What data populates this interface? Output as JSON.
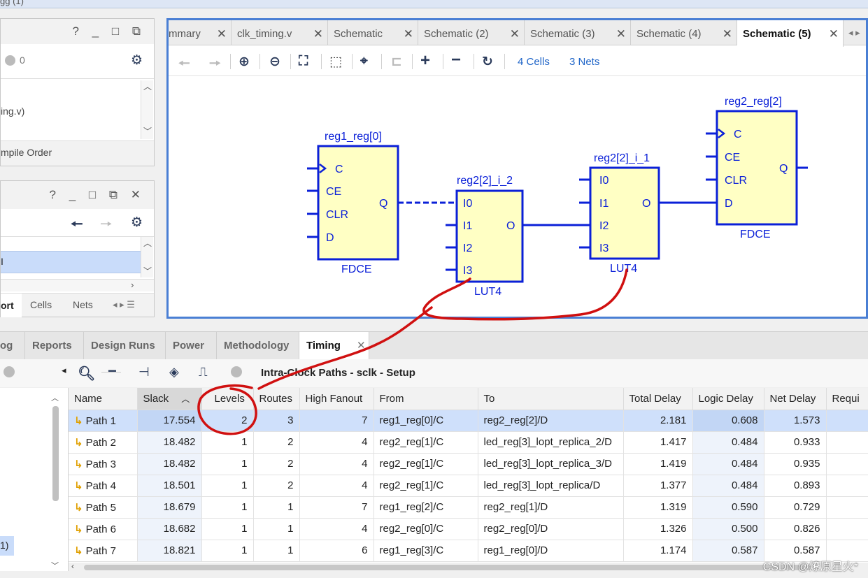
{
  "topbar": {
    "text": "gg   (1)"
  },
  "left_top": {
    "header_icons": "? _ □ ⧉",
    "badge_count": "0",
    "file_text": "ing.v)",
    "compile_order": "mpile Order"
  },
  "left_mid": {
    "header_icons": "? _ □ ⧉ ✕",
    "selected_item": "I",
    "tabs": [
      "ort",
      "Cells",
      "Nets"
    ]
  },
  "schematic": {
    "tabs": [
      {
        "label": "mmary"
      },
      {
        "label": "clk_timing.v"
      },
      {
        "label": "Schematic"
      },
      {
        "label": "Schematic (2)"
      },
      {
        "label": "Schematic (3)"
      },
      {
        "label": "Schematic (4)"
      },
      {
        "label": "Schematic (5)"
      }
    ],
    "cells_link": "4 Cells",
    "nets_link": "3 Nets",
    "cells": {
      "reg1": {
        "name": "reg1_reg[0]",
        "type": "FDCE",
        "pins_in": [
          "C",
          "CE",
          "CLR",
          "D"
        ],
        "pin_out": "Q"
      },
      "lut_a": {
        "name": "reg2[2]_i_2",
        "type": "LUT4",
        "pins_in": [
          "I0",
          "I1",
          "I2",
          "I3"
        ],
        "pin_out": "O"
      },
      "lut_b": {
        "name": "reg2[2]_i_1",
        "type": "LUT4",
        "pins_in": [
          "I0",
          "I1",
          "I2",
          "I3"
        ],
        "pin_out": "O"
      },
      "reg2": {
        "name": "reg2_reg[2]",
        "type": "FDCE",
        "pins_in": [
          "C",
          "CE",
          "CLR",
          "D"
        ],
        "pin_out": "Q"
      }
    },
    "colors": {
      "cell_fill": "#ffffc4",
      "wire": "#0b20d8",
      "annotation": "#d01010"
    }
  },
  "bottom": {
    "tabs": [
      "og",
      "Reports",
      "Design Runs",
      "Power",
      "Methodology",
      "Timing"
    ],
    "active_tab": "Timing",
    "view_title": "Intra-Clock Paths - sclk - Setup",
    "left_item": "1)",
    "table": {
      "columns": [
        "Name",
        "Slack",
        "Levels",
        "Routes",
        "High Fanout",
        "From",
        "To",
        "Total Delay",
        "Logic Delay",
        "Net Delay",
        "Requi"
      ],
      "rows": [
        {
          "name": "Path 1",
          "slack": "17.554",
          "levels": "2",
          "routes": "3",
          "fanout": "7",
          "from": "reg1_reg[0]/C",
          "to": "reg2_reg[2]/D",
          "total": "2.181",
          "logic": "0.608",
          "net": "1.573"
        },
        {
          "name": "Path 2",
          "slack": "18.482",
          "levels": "1",
          "routes": "2",
          "fanout": "4",
          "from": "reg2_reg[1]/C",
          "to": "led_reg[3]_lopt_replica_2/D",
          "total": "1.417",
          "logic": "0.484",
          "net": "0.933"
        },
        {
          "name": "Path 3",
          "slack": "18.482",
          "levels": "1",
          "routes": "2",
          "fanout": "4",
          "from": "reg2_reg[1]/C",
          "to": "led_reg[3]_lopt_replica_3/D",
          "total": "1.419",
          "logic": "0.484",
          "net": "0.935"
        },
        {
          "name": "Path 4",
          "slack": "18.501",
          "levels": "1",
          "routes": "2",
          "fanout": "4",
          "from": "reg2_reg[1]/C",
          "to": "led_reg[3]_lopt_replica/D",
          "total": "1.377",
          "logic": "0.484",
          "net": "0.893"
        },
        {
          "name": "Path 5",
          "slack": "18.679",
          "levels": "1",
          "routes": "1",
          "fanout": "7",
          "from": "reg1_reg[2]/C",
          "to": "reg2_reg[1]/D",
          "total": "1.319",
          "logic": "0.590",
          "net": "0.729"
        },
        {
          "name": "Path 6",
          "slack": "18.682",
          "levels": "1",
          "routes": "1",
          "fanout": "4",
          "from": "reg2_reg[0]/C",
          "to": "reg2_reg[0]/D",
          "total": "1.326",
          "logic": "0.500",
          "net": "0.826"
        },
        {
          "name": "Path 7",
          "slack": "18.821",
          "levels": "1",
          "routes": "1",
          "fanout": "6",
          "from": "reg1_reg[3]/C",
          "to": "reg1_reg[0]/D",
          "total": "1.174",
          "logic": "0.587",
          "net": "0.587"
        }
      ]
    }
  },
  "watermark": "CSDN @燎原星火*"
}
